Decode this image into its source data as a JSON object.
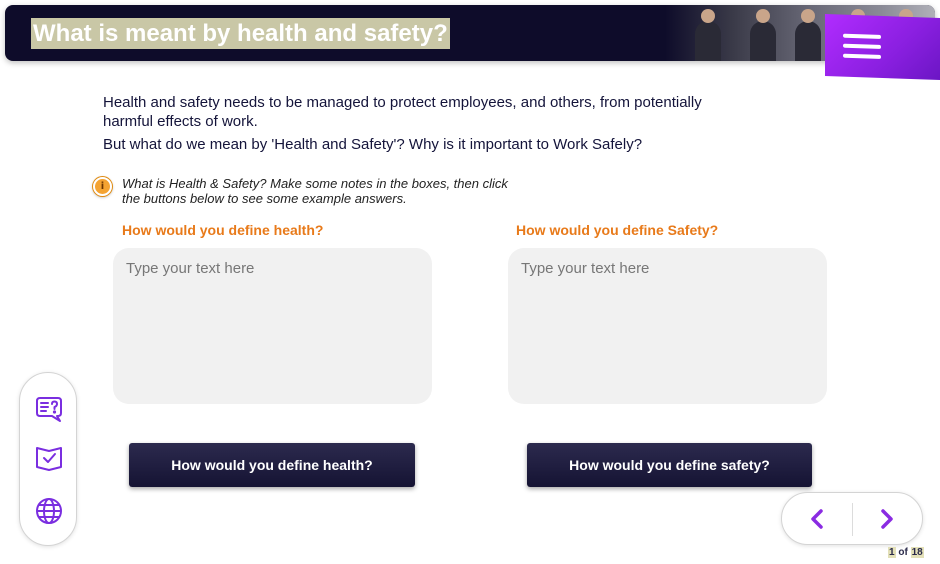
{
  "header": {
    "title": "What is meant by health and safety?",
    "background_color": "#0e0c2a",
    "menu_icon": "hamburger-menu-icon",
    "menu_color": "#9b27f0"
  },
  "intro": {
    "line1": "Health and safety needs to be managed to protect employees, and others, from potentially harmful effects of work.",
    "line2": "But what do we mean by 'Health and Safety'? Why is it important to Work Safely?"
  },
  "instruction": {
    "icon": "info-icon",
    "text": "What is Health & Safety? Make some notes in the boxes, then click the buttons below to see some example answers."
  },
  "questions": {
    "health": {
      "label": "How would you define health?",
      "placeholder": "Type your text here",
      "value": "",
      "button_label": "How would you define health?"
    },
    "safety": {
      "label": "How would you define Safety?",
      "placeholder": "Type your text here",
      "value": "",
      "button_label": "How would you define safety?"
    }
  },
  "side_rail": {
    "icons": [
      "speech-question-icon",
      "checked-book-icon",
      "globe-icon"
    ],
    "icon_color": "#7a2ee0"
  },
  "navigation": {
    "prev_icon": "chevron-left-icon",
    "next_icon": "chevron-right-icon",
    "accent": "#8a2be2"
  },
  "pagination": {
    "current": "1",
    "separator": "of",
    "total": "18"
  },
  "colors": {
    "question_label": "#e87a1a",
    "button_bg": "#1c1a3e",
    "textbox_bg": "#f1f1f1"
  }
}
